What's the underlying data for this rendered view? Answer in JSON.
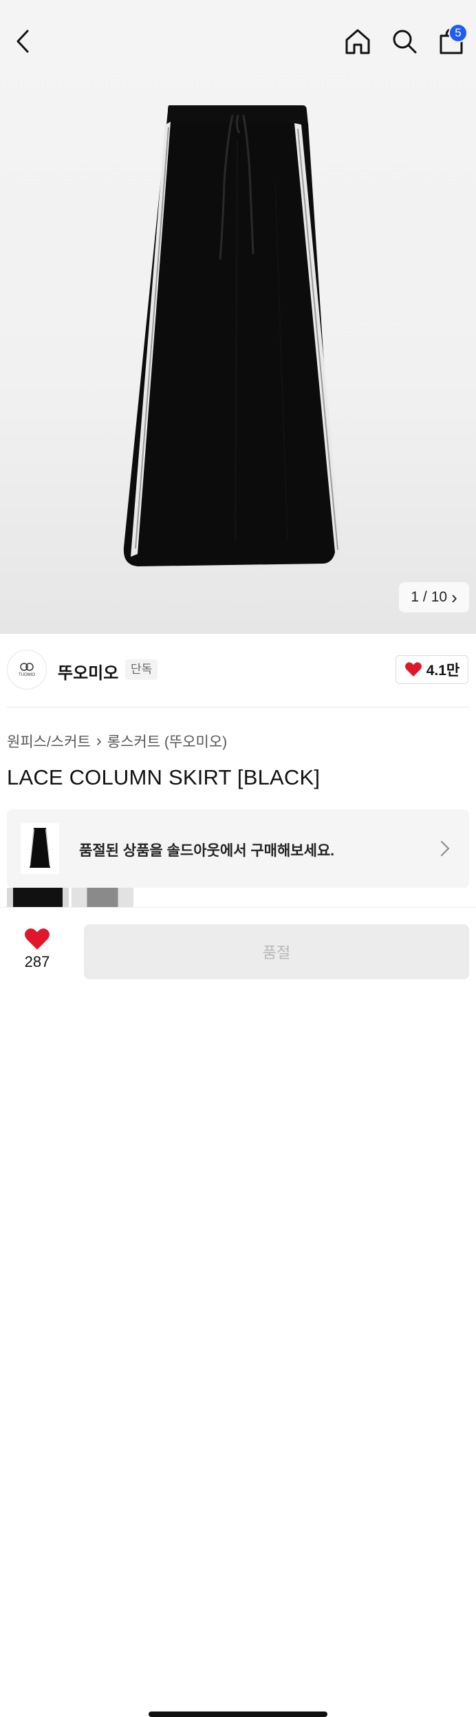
{
  "header": {
    "icons": [
      "back-arrow-icon",
      "home-icon",
      "search-icon",
      "shopping-bag-icon"
    ],
    "cart_count": "5"
  },
  "gallery": {
    "current": "1",
    "separator": "/",
    "total": "10",
    "next_glyph": "›"
  },
  "brand": {
    "logo_text": "TUOMIO",
    "name": "뚜오미오",
    "tag": "단독",
    "like_count": "4.1만"
  },
  "breadcrumb": {
    "category": "원피스/스커트",
    "separator": "›",
    "subcategory": "롱스커트 (뚜오미오)"
  },
  "product": {
    "title": "LACE COLUMN SKIRT [BLACK]"
  },
  "soldout_banner": {
    "text": "품절된 상품을 솔드아웃에서 구매해보세요."
  },
  "bottom_bar": {
    "wish_count": "287",
    "buy_label": "품절"
  },
  "colors": {
    "badge": "#1f5cf2",
    "heart": "#e0172b",
    "disabled_button": "#ececec"
  }
}
